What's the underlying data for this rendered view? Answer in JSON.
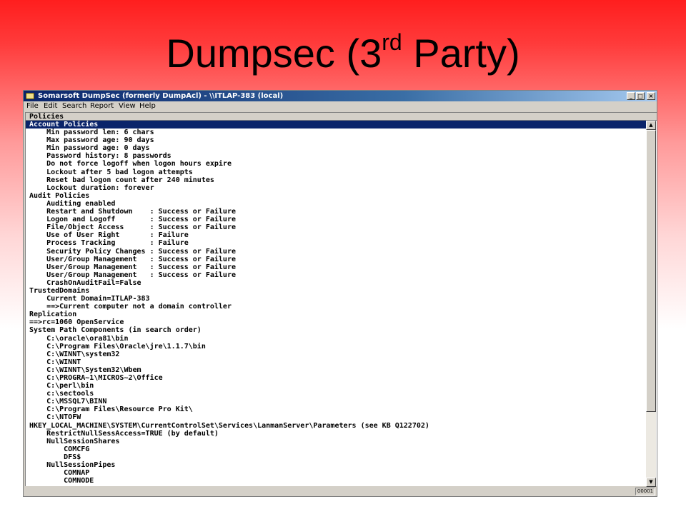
{
  "slide": {
    "title_main": "Dumpsec (3",
    "title_sup": "rd",
    "title_end": " Party)"
  },
  "window": {
    "title": "Somarsoft DumpSec (formerly DumpAcl) - \\\\ITLAP-383 (local)",
    "controls": [
      "_",
      "□",
      "×"
    ]
  },
  "menu": [
    "File",
    "Edit",
    "Search",
    "Report",
    "View",
    "Help"
  ],
  "column_header": "Policies",
  "lines": [
    "Account Policies",
    "    Min password len: 6 chars",
    "    Max password age: 90 days",
    "    Min password age: 0 days",
    "    Password history: 8 passwords",
    "    Do not force logoff when logon hours expire",
    "    Lockout after 5 bad logon attempts",
    "    Reset bad logon count after 240 minutes",
    "    Lockout duration: forever",
    "Audit Policies",
    "    Auditing enabled",
    "    Restart and Shutdown    : Success or Failure",
    "    Logon and Logoff        : Success or Failure",
    "    File/Object Access      : Success or Failure",
    "    Use of User Right       : Failure",
    "    Process Tracking        : Failure",
    "    Security Policy Changes : Success or Failure",
    "    User/Group Management   : Success or Failure",
    "    User/Group Management   : Success or Failure",
    "    User/Group Management   : Success or Failure",
    "    CrashOnAuditFail=False",
    "TrustedDomains",
    "    Current Domain=ITLAP-383",
    "    ==>Current computer not a domain controller",
    "Replication",
    "==>rc=1060 OpenService",
    "System Path Components (in search order)",
    "    C:\\oracle\\ora81\\bin",
    "    C:\\Program Files\\Oracle\\jre\\1.1.7\\bin",
    "    C:\\WINNT\\system32",
    "    C:\\WINNT",
    "    C:\\WINNT\\System32\\Wbem",
    "    C:\\PROGRA~1\\MICROS~2\\Office",
    "    C:\\perl\\bin",
    "    c:\\sectools",
    "    C:\\MSSQL7\\BINN",
    "    C:\\Program Files\\Resource Pro Kit\\",
    "    C:\\NTOFW",
    "HKEY_LOCAL_MACHINE\\SYSTEM\\CurrentControlSet\\Services\\LanmanServer\\Parameters (see KB Q122702)",
    "    RestrictNullSessAccess=TRUE (by default)",
    "    NullSessionShares",
    "        COMCFG",
    "        DFS$",
    "    NullSessionPipes",
    "        COMNAP",
    "        COMNODE"
  ],
  "selected_line": 0,
  "status": {
    "record": "00001"
  }
}
